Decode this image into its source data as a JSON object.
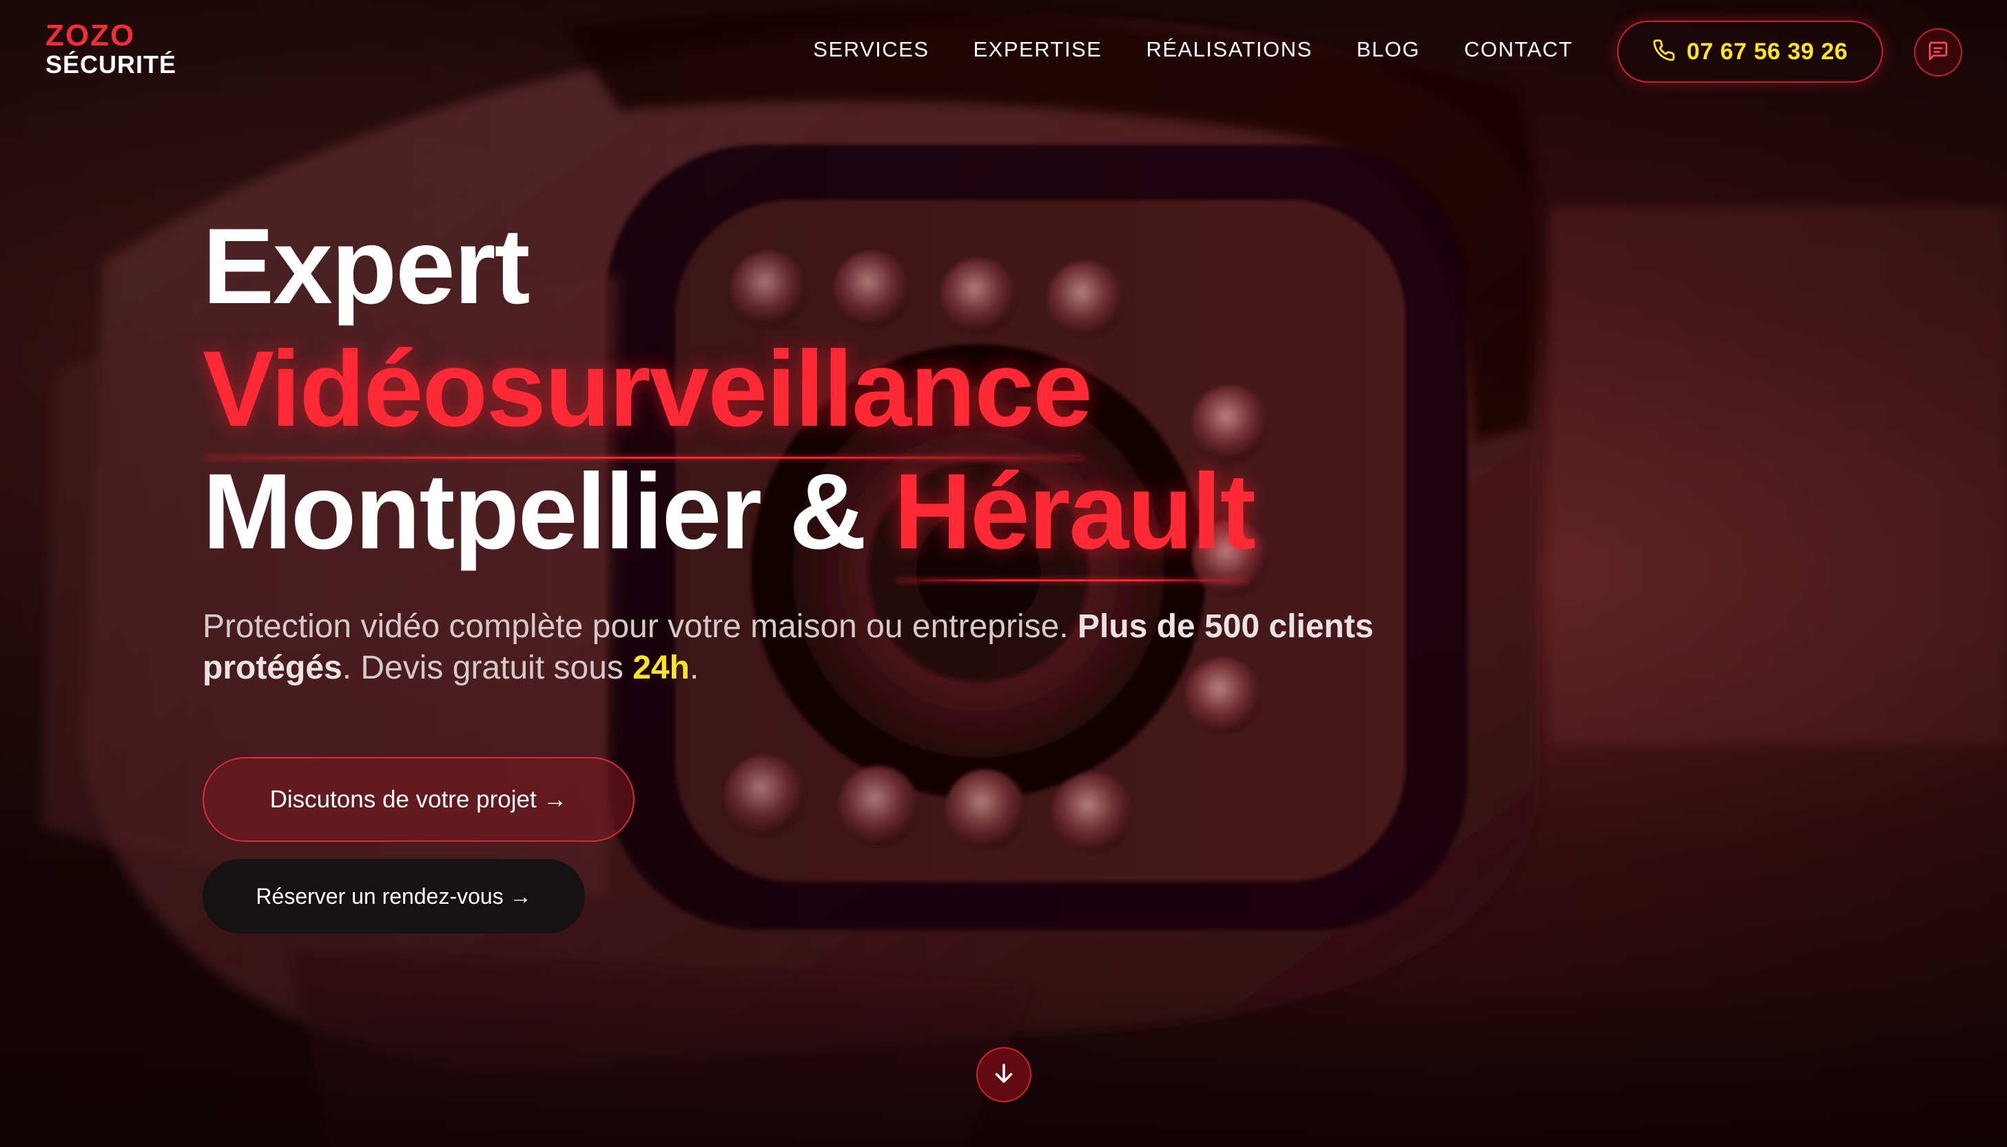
{
  "brand": {
    "name_top": "ZOZO",
    "name_bottom": "SÉCURITÉ"
  },
  "nav": {
    "items": [
      {
        "label": "SERVICES"
      },
      {
        "label": "EXPERTISE"
      },
      {
        "label": "RÉALISATIONS"
      },
      {
        "label": "BLOG"
      },
      {
        "label": "CONTACT"
      }
    ],
    "phone": {
      "icon": "phone-icon",
      "number": "07 67 56 39 26"
    },
    "chat": {
      "icon": "chat-icon"
    }
  },
  "hero": {
    "title_line1": "Expert",
    "title_line2": "Vidéosurveillance",
    "title_line3_a": "Montpellier & ",
    "title_line3_b": "Hérault",
    "subtitle": {
      "part1": "Protection vidéo complète pour votre maison ou entreprise. ",
      "bold": "Plus de 500 clients protégés",
      "part2": ". Devis gratuit sous ",
      "highlight": "24h",
      "part3": "."
    },
    "cta_primary": "Discutons de votre projet →",
    "cta_secondary": "Réserver un rendez-vous →",
    "scroll_icon": "arrow-down-icon"
  },
  "colors": {
    "accent_red": "#ff2a36",
    "accent_yellow": "#ffe521",
    "background": "#120406"
  }
}
